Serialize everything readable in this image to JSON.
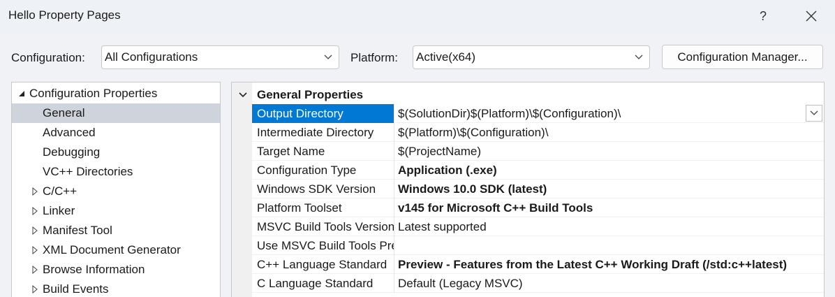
{
  "window": {
    "title": "Hello Property Pages",
    "help_label": "?"
  },
  "toolbar": {
    "configuration_label": "Configuration:",
    "configuration_value": "All Configurations",
    "platform_label": "Platform:",
    "platform_value": "Active(x64)",
    "config_manager_label": "Configuration Manager..."
  },
  "tree": {
    "root": "Configuration Properties",
    "items": [
      {
        "label": "General",
        "selected": true,
        "expandable": false
      },
      {
        "label": "Advanced",
        "expandable": false
      },
      {
        "label": "Debugging",
        "expandable": false
      },
      {
        "label": "VC++ Directories",
        "expandable": false
      },
      {
        "label": "C/C++",
        "expandable": true
      },
      {
        "label": "Linker",
        "expandable": true
      },
      {
        "label": "Manifest Tool",
        "expandable": true
      },
      {
        "label": "XML Document Generator",
        "expandable": true
      },
      {
        "label": "Browse Information",
        "expandable": true
      },
      {
        "label": "Build Events",
        "expandable": true
      }
    ]
  },
  "grid": {
    "category": "General Properties",
    "rows": [
      {
        "name": "Output Directory",
        "value": "$(SolutionDir)$(Platform)\\$(Configuration)\\",
        "bold": false,
        "selected": true
      },
      {
        "name": "Intermediate Directory",
        "value": "$(Platform)\\$(Configuration)\\",
        "bold": false
      },
      {
        "name": "Target Name",
        "value": "$(ProjectName)",
        "bold": false
      },
      {
        "name": "Configuration Type",
        "value": "Application (.exe)",
        "bold": true
      },
      {
        "name": "Windows SDK Version",
        "value": "Windows 10.0 SDK (latest)",
        "bold": true
      },
      {
        "name": "Platform Toolset",
        "value": "v145 for Microsoft C++ Build Tools",
        "bold": true
      },
      {
        "name": "MSVC Build Tools Version",
        "value": "Latest supported",
        "bold": false
      },
      {
        "name": "Use MSVC Build Tools Preview",
        "value": "",
        "bold": false
      },
      {
        "name": "C++ Language Standard",
        "value": "Preview - Features from the Latest C++ Working Draft (/std:c++latest)",
        "bold": true
      },
      {
        "name": "C Language Standard",
        "value": "Default (Legacy MSVC)",
        "bold": false
      }
    ]
  }
}
